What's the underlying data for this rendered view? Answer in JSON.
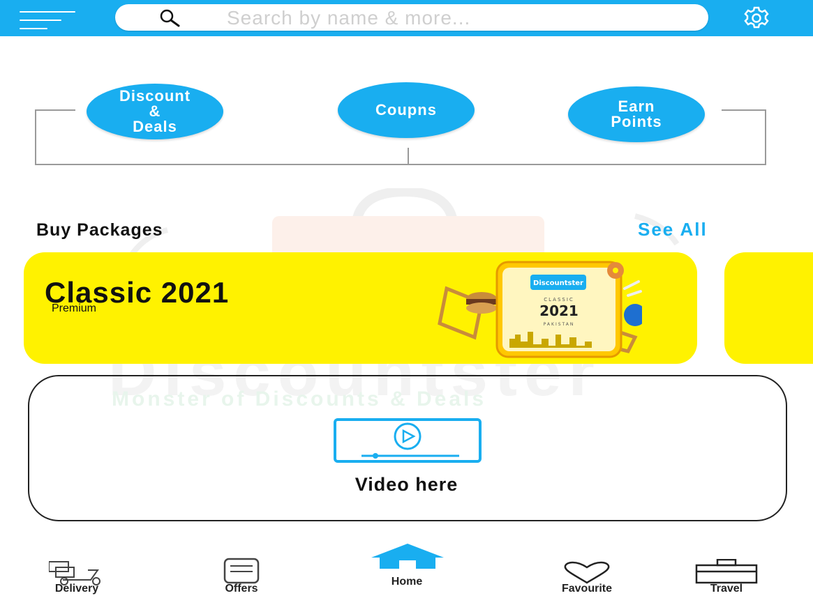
{
  "search": {
    "placeholder": "Search by name & more..."
  },
  "categories": [
    {
      "label": "Discount\n&\nDeals"
    },
    {
      "label": "Coupns"
    },
    {
      "label": "Earn\nPoints"
    }
  ],
  "watermark": {
    "title": "Discountster",
    "tagline": "Monster of Discounts & Deals"
  },
  "packages": {
    "title": "Buy Packages",
    "see_all": "See All",
    "cards": [
      {
        "title": "Classic 2021",
        "subtitle": "Premium",
        "art": {
          "brand": "Discountster",
          "edition": "CLASSIC",
          "year": "2021",
          "country": "PAKISTAN"
        }
      }
    ]
  },
  "video": {
    "label": "Video here"
  },
  "nav": {
    "delivery": "Delivery",
    "offers": "Offers",
    "home": "Home",
    "favourite": "Favourite",
    "travel": "Travel"
  },
  "colors": {
    "primary": "#19aef0",
    "card": "#fff200",
    "text": "#111111"
  }
}
